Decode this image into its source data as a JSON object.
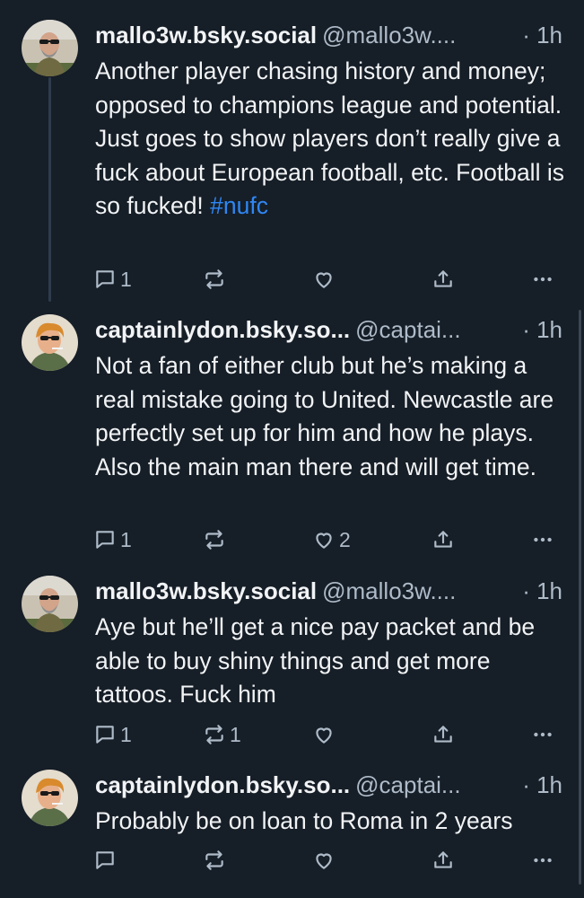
{
  "posts": [
    {
      "display_name": "mallo3w.bsky.social",
      "handle": "@mallo3w....",
      "time": "· 1h",
      "text": "Another player chasing history and money; opposed to champions league and potential. Just goes to show players don’t really give a fuck about European football, etc. Football is so fucked!",
      "hashtag": "#nufc",
      "reply_count": "1",
      "repost_count": "",
      "like_count": ""
    },
    {
      "display_name": "captainlydon.bsky.so...",
      "handle": "@captai...",
      "time": "· 1h",
      "text": "Not a fan of either club but he’s making a real mistake going to United. Newcastle are perfectly set up for him and how he plays. Also the main man there and will get time.",
      "reply_count": "1",
      "repost_count": "",
      "like_count": "2"
    },
    {
      "display_name": "mallo3w.bsky.social",
      "handle": "@mallo3w....",
      "time": "· 1h",
      "text": "Aye but he’ll get a nice pay packet and be able to buy shiny things and get more tattoos. Fuck him",
      "reply_count": "1",
      "repost_count": "1",
      "like_count": ""
    },
    {
      "display_name": "captainlydon.bsky.so...",
      "handle": "@captai...",
      "time": "· 1h",
      "text": "Probably be on loan to Roma in 2 years",
      "reply_count": "",
      "repost_count": "",
      "like_count": ""
    }
  ],
  "icons": {
    "reply": "reply-icon",
    "repost": "repost-icon",
    "like": "heart-icon",
    "share": "share-icon",
    "more": "more-icon"
  },
  "colors": {
    "background": "#161e27",
    "text": "#f1f3f5",
    "muted": "#aebbc9",
    "link": "#2f87f3",
    "thread_line": "#2e3c4d"
  }
}
